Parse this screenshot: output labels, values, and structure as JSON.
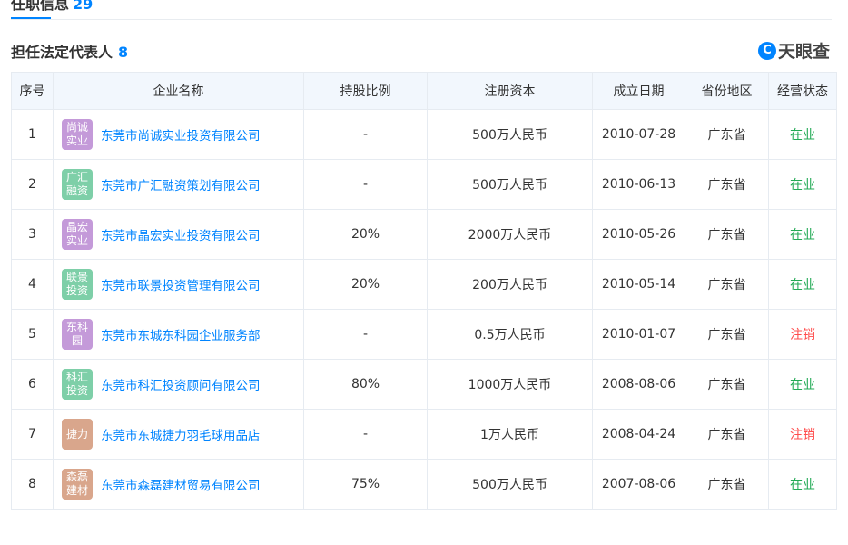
{
  "top_tab": {
    "label": "任职信息",
    "count": "29"
  },
  "section": {
    "title": "担任法定代表人",
    "count": "8"
  },
  "brand": {
    "logo_glyph": "C",
    "name": "天眼查"
  },
  "table": {
    "headers": [
      "序号",
      "企业名称",
      "持股比例",
      "注册资本",
      "成立日期",
      "省份地区",
      "经营状态"
    ],
    "rows": [
      {
        "index": "1",
        "badge": "尚诚实业",
        "badge_color": "#c49ad9",
        "name": "东莞市尚诚实业投资有限公司",
        "share": "-",
        "capital": "500万人民币",
        "date": "2010-07-28",
        "province": "广东省",
        "status": "在业",
        "status_type": "active"
      },
      {
        "index": "2",
        "badge": "广汇融资",
        "badge_color": "#7ecfa8",
        "name": "东莞市广汇融资策划有限公司",
        "share": "-",
        "capital": "500万人民币",
        "date": "2010-06-13",
        "province": "广东省",
        "status": "在业",
        "status_type": "active"
      },
      {
        "index": "3",
        "badge": "晶宏实业",
        "badge_color": "#c49ad9",
        "name": "东莞市晶宏实业投资有限公司",
        "share": "20%",
        "capital": "2000万人民币",
        "date": "2010-05-26",
        "province": "广东省",
        "status": "在业",
        "status_type": "active"
      },
      {
        "index": "4",
        "badge": "联景投资",
        "badge_color": "#7ecfa8",
        "name": "东莞市联景投资管理有限公司",
        "share": "20%",
        "capital": "200万人民币",
        "date": "2010-05-14",
        "province": "广东省",
        "status": "在业",
        "status_type": "active"
      },
      {
        "index": "5",
        "badge": "东科园",
        "badge_color": "#c49ad9",
        "name": "东莞市东城东科园企业服务部",
        "share": "-",
        "capital": "0.5万人民币",
        "date": "2010-01-07",
        "province": "广东省",
        "status": "注销",
        "status_type": "cancel"
      },
      {
        "index": "6",
        "badge": "科汇投资",
        "badge_color": "#7ecfa8",
        "name": "东莞市科汇投资顾问有限公司",
        "share": "80%",
        "capital": "1000万人民币",
        "date": "2008-08-06",
        "province": "广东省",
        "status": "在业",
        "status_type": "active"
      },
      {
        "index": "7",
        "badge": "捷力",
        "badge_color": "#d9a68c",
        "name": "东莞市东城捷力羽毛球用品店",
        "share": "-",
        "capital": "1万人民币",
        "date": "2008-04-24",
        "province": "广东省",
        "status": "注销",
        "status_type": "cancel"
      },
      {
        "index": "8",
        "badge": "森磊建材",
        "badge_color": "#d9a68c",
        "name": "东莞市森磊建材贸易有限公司",
        "share": "75%",
        "capital": "500万人民币",
        "date": "2007-08-06",
        "province": "广东省",
        "status": "在业",
        "status_type": "active"
      }
    ]
  }
}
